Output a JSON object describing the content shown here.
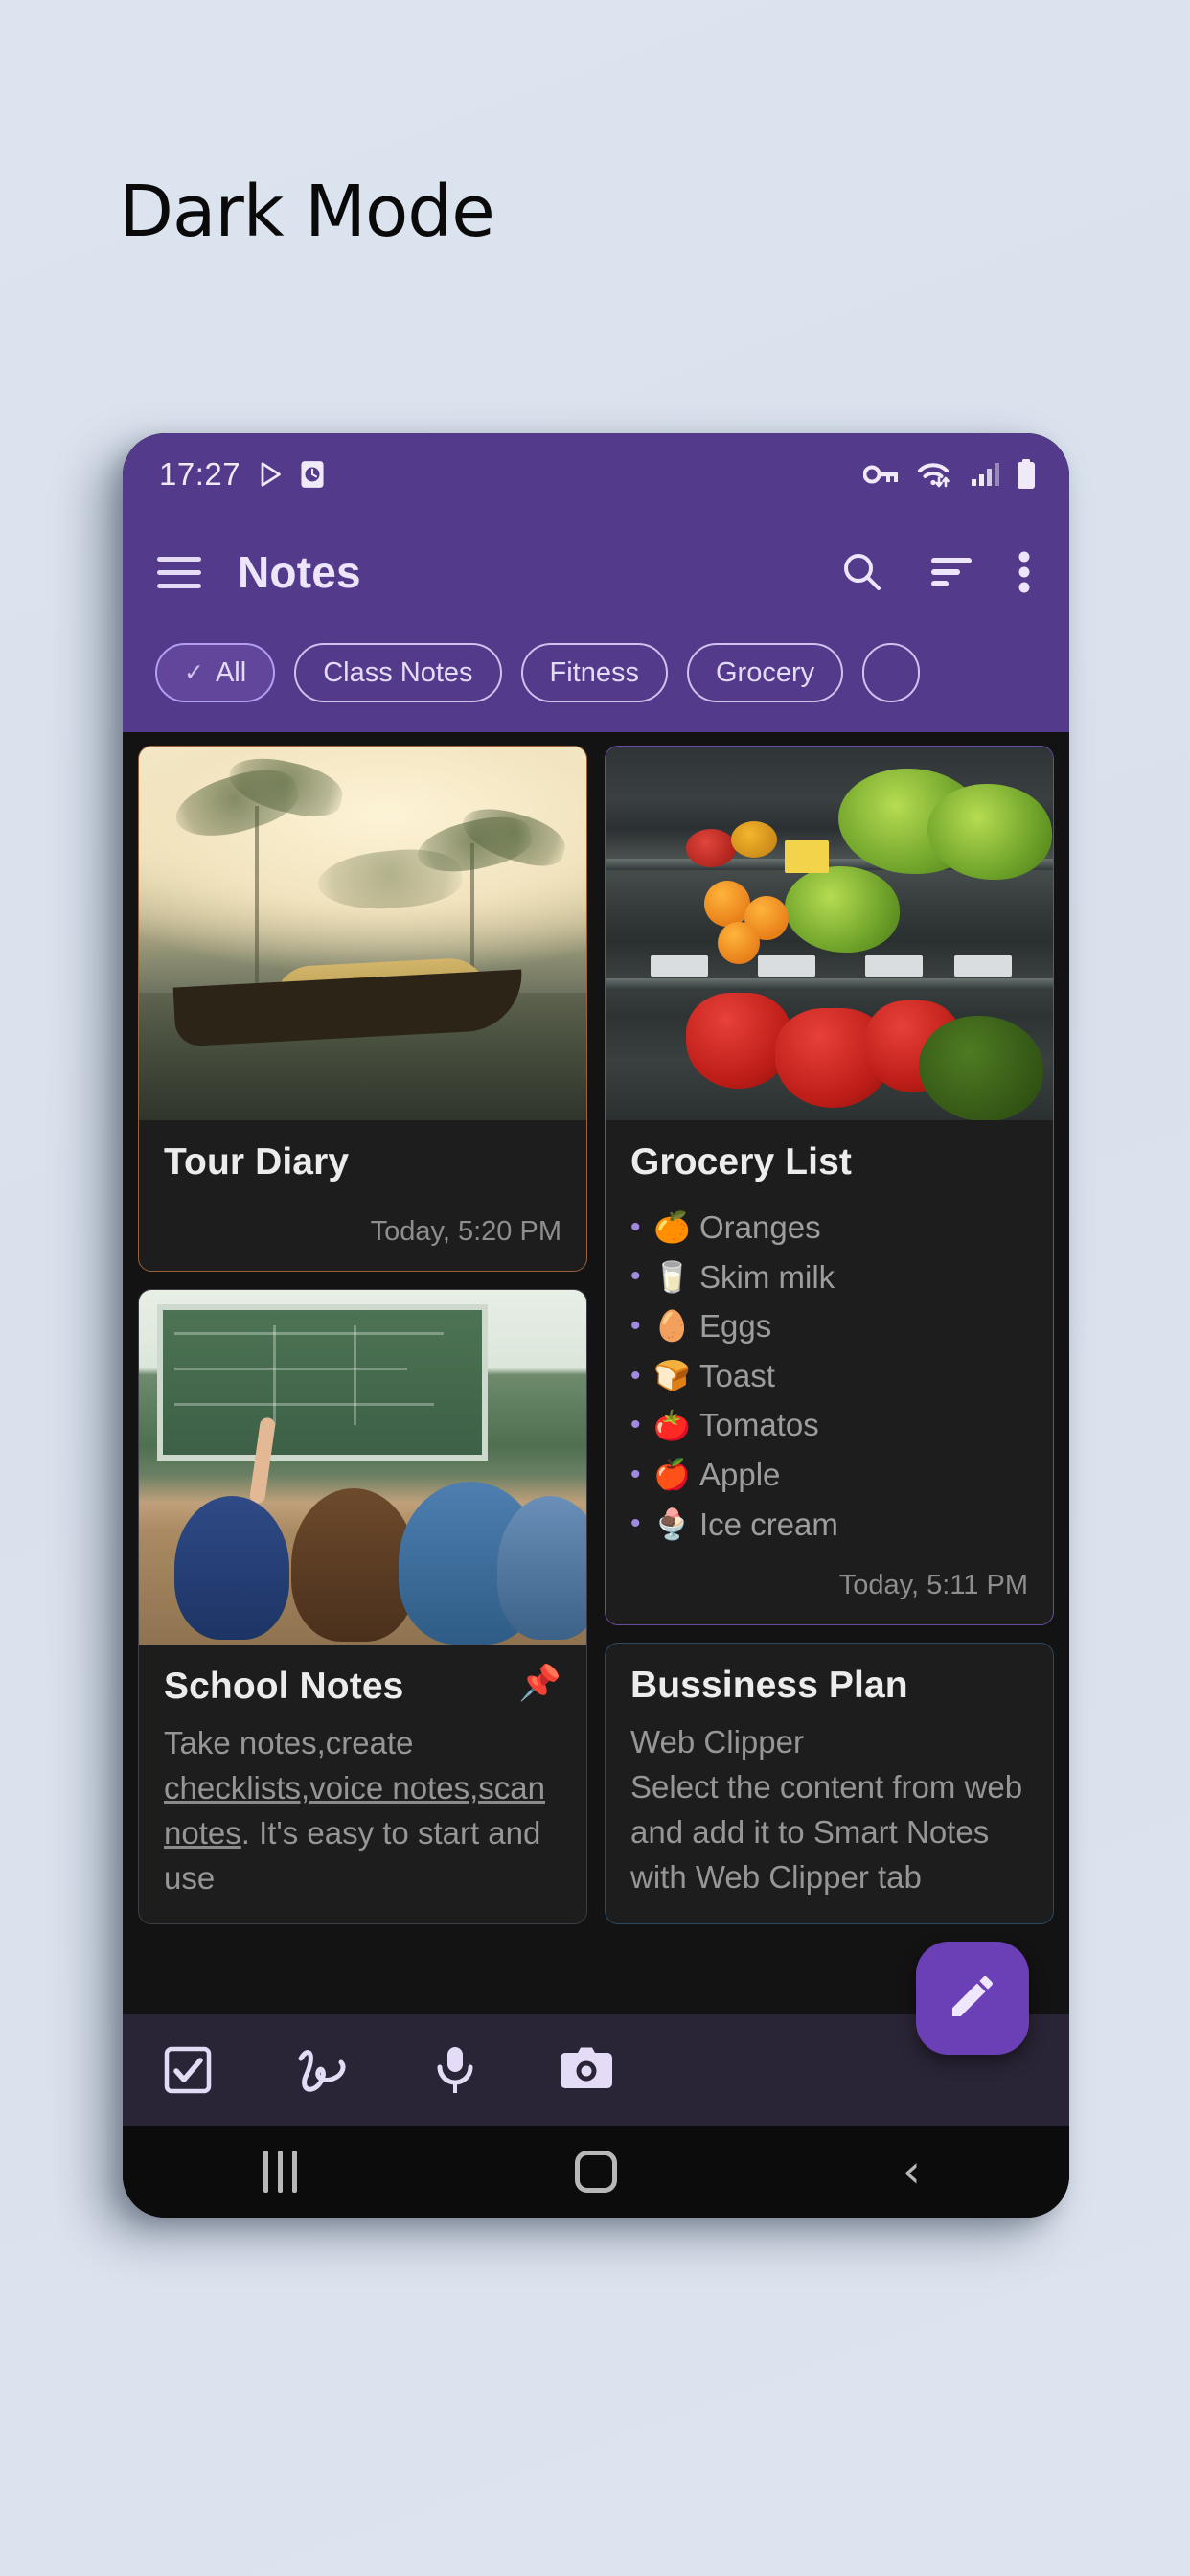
{
  "page": {
    "heading": "Dark Mode",
    "background_color": "#dbe3ef"
  },
  "theme": {
    "accent_purple": "#533a8b",
    "fab_purple": "#6b3fb5",
    "card_background": "#1d1d1d",
    "screen_background": "#131313",
    "bottom_bar": "#2a2536"
  },
  "status_bar": {
    "time": "17:27",
    "left_icons": [
      "play-store-icon",
      "clock-icon"
    ],
    "right_icons": [
      "vpn-key-icon",
      "wifi-icon",
      "signal-icon",
      "battery-icon"
    ]
  },
  "app_bar": {
    "menu_icon": "hamburger-menu-icon",
    "title": "Notes",
    "actions": [
      "search-icon",
      "sort-icon",
      "overflow-menu-icon"
    ]
  },
  "chips": [
    {
      "label": "All",
      "selected": true,
      "check": "✓"
    },
    {
      "label": "Class Notes",
      "selected": false
    },
    {
      "label": "Fitness",
      "selected": false
    },
    {
      "label": "Grocery",
      "selected": false
    },
    {
      "label": "",
      "selected": false
    }
  ],
  "notes": {
    "tour_diary": {
      "title": "Tour Diary",
      "time": "Today, 5:20 PM",
      "image": "backwater-boat-palms-photo"
    },
    "grocery_list": {
      "title": "Grocery List",
      "time": "Today, 5:11 PM",
      "image": "supermarket-produce-photo",
      "items": [
        {
          "emoji": "🍊",
          "label": "Oranges"
        },
        {
          "emoji": "🥛",
          "label": "Skim milk"
        },
        {
          "emoji": "🥚",
          "label": "Eggs"
        },
        {
          "emoji": "🍞",
          "label": "Toast"
        },
        {
          "emoji": "🍅",
          "label": "Tomatos"
        },
        {
          "emoji": "🍎",
          "label": "Apple"
        },
        {
          "emoji": "🍨",
          "label": "Ice cream"
        }
      ]
    },
    "school_notes": {
      "title": "School Notes",
      "pin": "📌",
      "image": "classroom-students-photo",
      "snippet_part1": "Take notes,create ",
      "snippet_underlined": "checklists,voice notes,scan notes",
      "snippet_part2": ". It's easy to start and use"
    },
    "business_plan": {
      "title": "Bussiness Plan",
      "snippet_line1": "Web Clipper",
      "snippet_line2": "Select the content from web and add it to Smart Notes with Web Clipper tab"
    }
  },
  "bottom_toolbar": {
    "items": [
      "checklist-icon",
      "handwriting-icon",
      "microphone-icon",
      "camera-icon"
    ]
  },
  "fab": {
    "icon": "pencil-edit-icon"
  },
  "nav_bar": {
    "items": [
      "recents-icon",
      "home-icon",
      "back-icon"
    ]
  }
}
